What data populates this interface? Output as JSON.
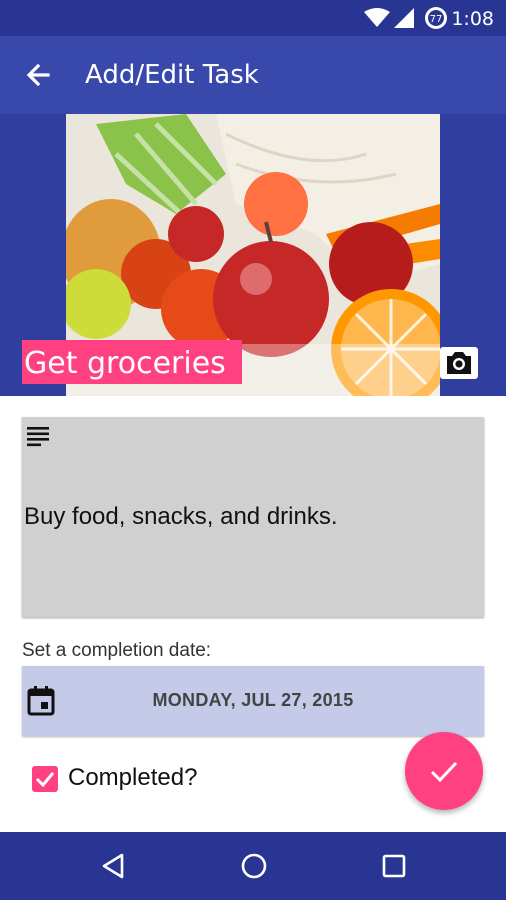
{
  "status_bar": {
    "time": "1:08",
    "battery_level": "77"
  },
  "app_bar": {
    "title": "Add/Edit Task"
  },
  "task": {
    "title": "Get groceries",
    "description": "Buy food, snacks, and drinks.",
    "date_label": "Set a completion date:",
    "date_value": "MONDAY, JUL 27, 2015",
    "completed_label": "Completed?",
    "completed": true
  },
  "icons": {
    "back": "arrow-back-icon",
    "camera": "camera-icon",
    "description": "notes-lines-icon",
    "calendar": "calendar-icon",
    "checkbox": "checkbox-checked-icon",
    "fab": "check-icon"
  },
  "colors": {
    "primary": "#3949ab",
    "primary_dark": "#283593",
    "accent": "#ff4081",
    "date_bg": "#c5cae9",
    "desc_bg": "#d0d0d0"
  }
}
